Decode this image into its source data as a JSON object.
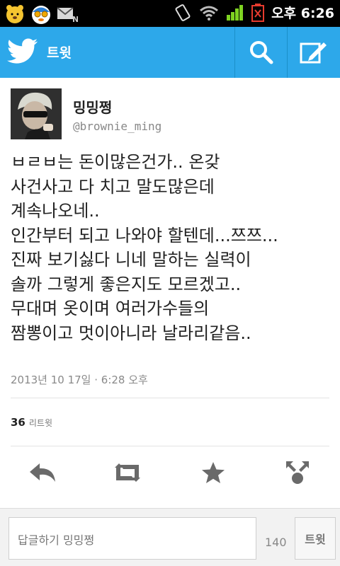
{
  "status_bar": {
    "time": "오후 6:26"
  },
  "app_bar": {
    "title": "트윗",
    "icons": [
      "twitter-bird-icon",
      "search-icon",
      "compose-icon"
    ],
    "color": "#2da8ea"
  },
  "tweet": {
    "display_name": "밍밍쩡",
    "handle": "@brownie_ming",
    "text": "ㅂㄹㅂ는 돈이많은건가.. 온갖\n사건사고 다 치고 말도많은데\n계속나오네..\n인간부터 되고 나와야 할텐데...쯔쯔...\n진짜 보기싫다 니네 말하는 실력이\n솔까 그렇게 좋은지도 모르겠고..\n무대며 옷이며 여러가수들의\n짬뽕이고  멋이아니라 날라리같음..",
    "timestamp": "2013년 10 17일  ·  6:28 오후",
    "retweet_count": "36",
    "retweet_label": "리트윗"
  },
  "actions": [
    "reply-icon",
    "retweet-icon",
    "favorite-icon",
    "share-icon"
  ],
  "compose": {
    "placeholder": "답글하기 밍밍쩡",
    "char_count": "140",
    "send_label": "트윗"
  }
}
